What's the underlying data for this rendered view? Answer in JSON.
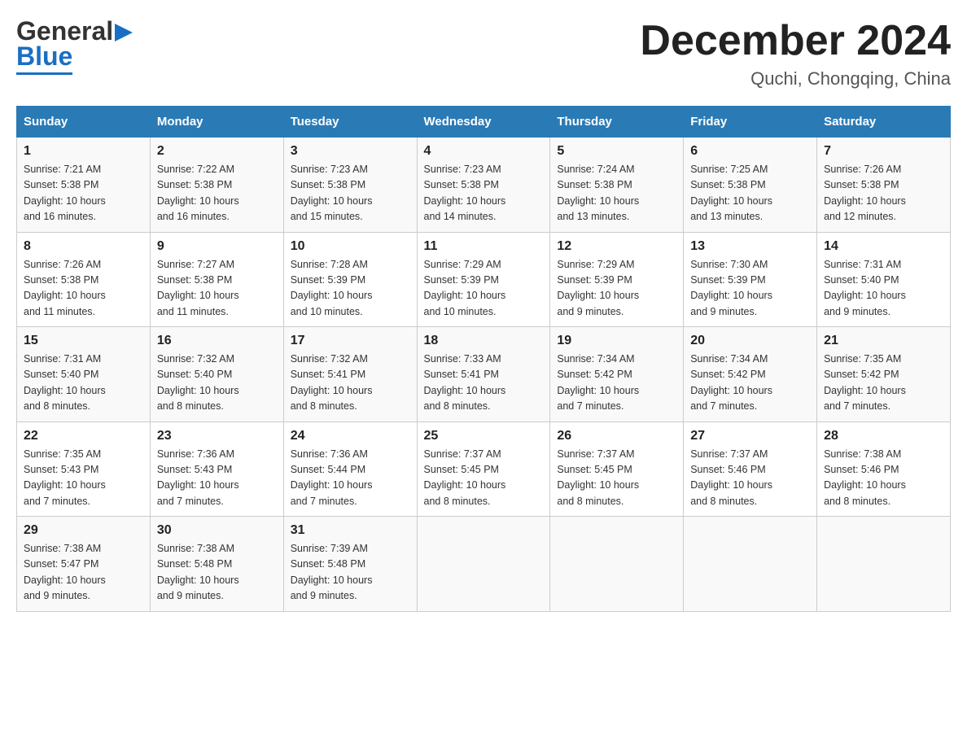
{
  "header": {
    "month_title": "December 2024",
    "location": "Quchi, Chongqing, China",
    "logo_general": "General",
    "logo_blue": "Blue"
  },
  "days_of_week": [
    "Sunday",
    "Monday",
    "Tuesday",
    "Wednesday",
    "Thursday",
    "Friday",
    "Saturday"
  ],
  "weeks": [
    [
      {
        "day": "1",
        "sunrise": "7:21 AM",
        "sunset": "5:38 PM",
        "daylight": "10 hours and 16 minutes."
      },
      {
        "day": "2",
        "sunrise": "7:22 AM",
        "sunset": "5:38 PM",
        "daylight": "10 hours and 16 minutes."
      },
      {
        "day": "3",
        "sunrise": "7:23 AM",
        "sunset": "5:38 PM",
        "daylight": "10 hours and 15 minutes."
      },
      {
        "day": "4",
        "sunrise": "7:23 AM",
        "sunset": "5:38 PM",
        "daylight": "10 hours and 14 minutes."
      },
      {
        "day": "5",
        "sunrise": "7:24 AM",
        "sunset": "5:38 PM",
        "daylight": "10 hours and 13 minutes."
      },
      {
        "day": "6",
        "sunrise": "7:25 AM",
        "sunset": "5:38 PM",
        "daylight": "10 hours and 13 minutes."
      },
      {
        "day": "7",
        "sunrise": "7:26 AM",
        "sunset": "5:38 PM",
        "daylight": "10 hours and 12 minutes."
      }
    ],
    [
      {
        "day": "8",
        "sunrise": "7:26 AM",
        "sunset": "5:38 PM",
        "daylight": "10 hours and 11 minutes."
      },
      {
        "day": "9",
        "sunrise": "7:27 AM",
        "sunset": "5:38 PM",
        "daylight": "10 hours and 11 minutes."
      },
      {
        "day": "10",
        "sunrise": "7:28 AM",
        "sunset": "5:39 PM",
        "daylight": "10 hours and 10 minutes."
      },
      {
        "day": "11",
        "sunrise": "7:29 AM",
        "sunset": "5:39 PM",
        "daylight": "10 hours and 10 minutes."
      },
      {
        "day": "12",
        "sunrise": "7:29 AM",
        "sunset": "5:39 PM",
        "daylight": "10 hours and 9 minutes."
      },
      {
        "day": "13",
        "sunrise": "7:30 AM",
        "sunset": "5:39 PM",
        "daylight": "10 hours and 9 minutes."
      },
      {
        "day": "14",
        "sunrise": "7:31 AM",
        "sunset": "5:40 PM",
        "daylight": "10 hours and 9 minutes."
      }
    ],
    [
      {
        "day": "15",
        "sunrise": "7:31 AM",
        "sunset": "5:40 PM",
        "daylight": "10 hours and 8 minutes."
      },
      {
        "day": "16",
        "sunrise": "7:32 AM",
        "sunset": "5:40 PM",
        "daylight": "10 hours and 8 minutes."
      },
      {
        "day": "17",
        "sunrise": "7:32 AM",
        "sunset": "5:41 PM",
        "daylight": "10 hours and 8 minutes."
      },
      {
        "day": "18",
        "sunrise": "7:33 AM",
        "sunset": "5:41 PM",
        "daylight": "10 hours and 8 minutes."
      },
      {
        "day": "19",
        "sunrise": "7:34 AM",
        "sunset": "5:42 PM",
        "daylight": "10 hours and 7 minutes."
      },
      {
        "day": "20",
        "sunrise": "7:34 AM",
        "sunset": "5:42 PM",
        "daylight": "10 hours and 7 minutes."
      },
      {
        "day": "21",
        "sunrise": "7:35 AM",
        "sunset": "5:42 PM",
        "daylight": "10 hours and 7 minutes."
      }
    ],
    [
      {
        "day": "22",
        "sunrise": "7:35 AM",
        "sunset": "5:43 PM",
        "daylight": "10 hours and 7 minutes."
      },
      {
        "day": "23",
        "sunrise": "7:36 AM",
        "sunset": "5:43 PM",
        "daylight": "10 hours and 7 minutes."
      },
      {
        "day": "24",
        "sunrise": "7:36 AM",
        "sunset": "5:44 PM",
        "daylight": "10 hours and 7 minutes."
      },
      {
        "day": "25",
        "sunrise": "7:37 AM",
        "sunset": "5:45 PM",
        "daylight": "10 hours and 8 minutes."
      },
      {
        "day": "26",
        "sunrise": "7:37 AM",
        "sunset": "5:45 PM",
        "daylight": "10 hours and 8 minutes."
      },
      {
        "day": "27",
        "sunrise": "7:37 AM",
        "sunset": "5:46 PM",
        "daylight": "10 hours and 8 minutes."
      },
      {
        "day": "28",
        "sunrise": "7:38 AM",
        "sunset": "5:46 PM",
        "daylight": "10 hours and 8 minutes."
      }
    ],
    [
      {
        "day": "29",
        "sunrise": "7:38 AM",
        "sunset": "5:47 PM",
        "daylight": "10 hours and 9 minutes."
      },
      {
        "day": "30",
        "sunrise": "7:38 AM",
        "sunset": "5:48 PM",
        "daylight": "10 hours and 9 minutes."
      },
      {
        "day": "31",
        "sunrise": "7:39 AM",
        "sunset": "5:48 PM",
        "daylight": "10 hours and 9 minutes."
      },
      null,
      null,
      null,
      null
    ]
  ],
  "labels": {
    "sunrise": "Sunrise:",
    "sunset": "Sunset:",
    "daylight": "Daylight:"
  }
}
